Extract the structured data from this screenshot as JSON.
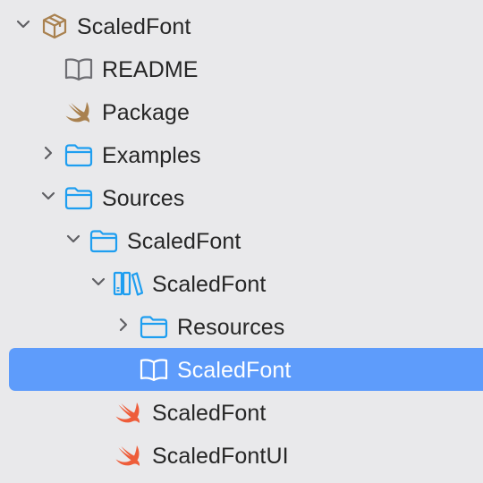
{
  "accent_color": "#5e9cfb",
  "folder_icon_color": "#1e9ef0",
  "tree": [
    {
      "label": "ScaledFont",
      "icon": "package-icon",
      "disclosure": "expanded"
    },
    {
      "label": "README",
      "icon": "book-icon",
      "disclosure": "none"
    },
    {
      "label": "Package",
      "icon": "swift-file-icon",
      "disclosure": "none"
    },
    {
      "label": "Examples",
      "icon": "folder-icon",
      "disclosure": "collapsed"
    },
    {
      "label": "Sources",
      "icon": "folder-icon",
      "disclosure": "expanded"
    },
    {
      "label": "ScaledFont",
      "icon": "folder-icon",
      "disclosure": "expanded"
    },
    {
      "label": "ScaledFont",
      "icon": "documentation-catalog-icon",
      "disclosure": "expanded"
    },
    {
      "label": "Resources",
      "icon": "folder-icon",
      "disclosure": "collapsed"
    },
    {
      "label": "ScaledFont",
      "icon": "book-icon",
      "disclosure": "none",
      "selected": true
    },
    {
      "label": "ScaledFont",
      "icon": "swift-file-icon",
      "disclosure": "none"
    },
    {
      "label": "ScaledFontUI",
      "icon": "swift-file-icon",
      "disclosure": "none"
    }
  ]
}
